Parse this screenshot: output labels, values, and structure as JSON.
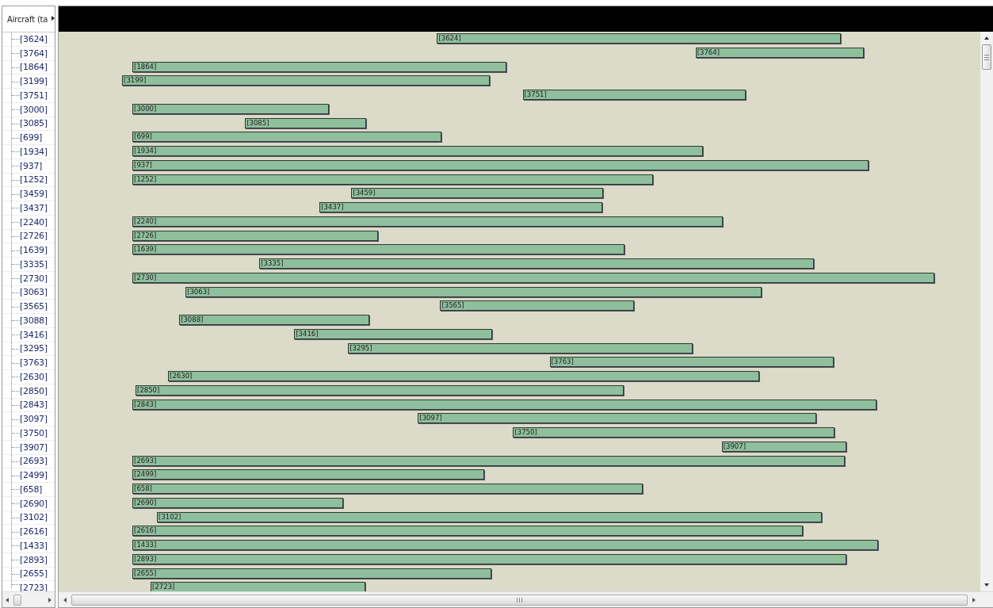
{
  "tree": {
    "header": "Aircraft (ta",
    "items": [
      {
        "label": "[3624]"
      },
      {
        "label": "[3764]"
      },
      {
        "label": "[1864]"
      },
      {
        "label": "[3199]"
      },
      {
        "label": "[3751]"
      },
      {
        "label": "[3000]"
      },
      {
        "label": "[3085]"
      },
      {
        "label": "[699]"
      },
      {
        "label": "[1934]"
      },
      {
        "label": "[937]"
      },
      {
        "label": "[1252]"
      },
      {
        "label": "[3459]"
      },
      {
        "label": "[3437]"
      },
      {
        "label": "[2240]"
      },
      {
        "label": "[2726]"
      },
      {
        "label": "[1639]"
      },
      {
        "label": "[3335]"
      },
      {
        "label": "[2730]"
      },
      {
        "label": "[3063]"
      },
      {
        "label": "[3565]"
      },
      {
        "label": "[3088]"
      },
      {
        "label": "[3416]"
      },
      {
        "label": "[3295]"
      },
      {
        "label": "[3763]"
      },
      {
        "label": "[2630]"
      },
      {
        "label": "[2850]"
      },
      {
        "label": "[2843]"
      },
      {
        "label": "[3097]"
      },
      {
        "label": "[3750]"
      },
      {
        "label": "[3907]"
      },
      {
        "label": "[2693]"
      },
      {
        "label": "[2499]"
      },
      {
        "label": "[658]"
      },
      {
        "label": "[2690]"
      },
      {
        "label": "[3102]"
      },
      {
        "label": "[2616]"
      },
      {
        "label": "[1433]"
      },
      {
        "label": "[2893]"
      },
      {
        "label": "[2655]"
      },
      {
        "label": "[2723]"
      }
    ]
  },
  "gantt": {
    "bars": [
      {
        "label": "[3624]"
      },
      {
        "label": "[3764]"
      },
      {
        "label": "[1864]"
      },
      {
        "label": "[3199]"
      },
      {
        "label": "[3751]"
      },
      {
        "label": "[3000]"
      },
      {
        "label": "[3085]"
      },
      {
        "label": "[699]"
      },
      {
        "label": "[1934]"
      },
      {
        "label": "[937]"
      },
      {
        "label": "[1252]"
      },
      {
        "label": "[3459]"
      },
      {
        "label": "[3437]"
      },
      {
        "label": "[2240]"
      },
      {
        "label": "[2726]"
      },
      {
        "label": "[1639]"
      },
      {
        "label": "[3335]"
      },
      {
        "label": "[2730]"
      },
      {
        "label": "[3063]"
      },
      {
        "label": "[3565]"
      },
      {
        "label": "[3088]"
      },
      {
        "label": "[3416]"
      },
      {
        "label": "[3295]"
      },
      {
        "label": "[3763]"
      },
      {
        "label": "[2630]"
      },
      {
        "label": "[2850]"
      },
      {
        "label": "[2843]"
      },
      {
        "label": "[3097]"
      },
      {
        "label": "[3750]"
      },
      {
        "label": "[3907]"
      },
      {
        "label": "[2693]"
      },
      {
        "label": "[2499]"
      },
      {
        "label": "[658]"
      },
      {
        "label": "[2690]"
      },
      {
        "label": "[3102]"
      },
      {
        "label": "[2616]"
      },
      {
        "label": "[1433]"
      },
      {
        "label": "[2893]"
      },
      {
        "label": "[2655]"
      },
      {
        "label": "[2723]"
      }
    ]
  }
}
